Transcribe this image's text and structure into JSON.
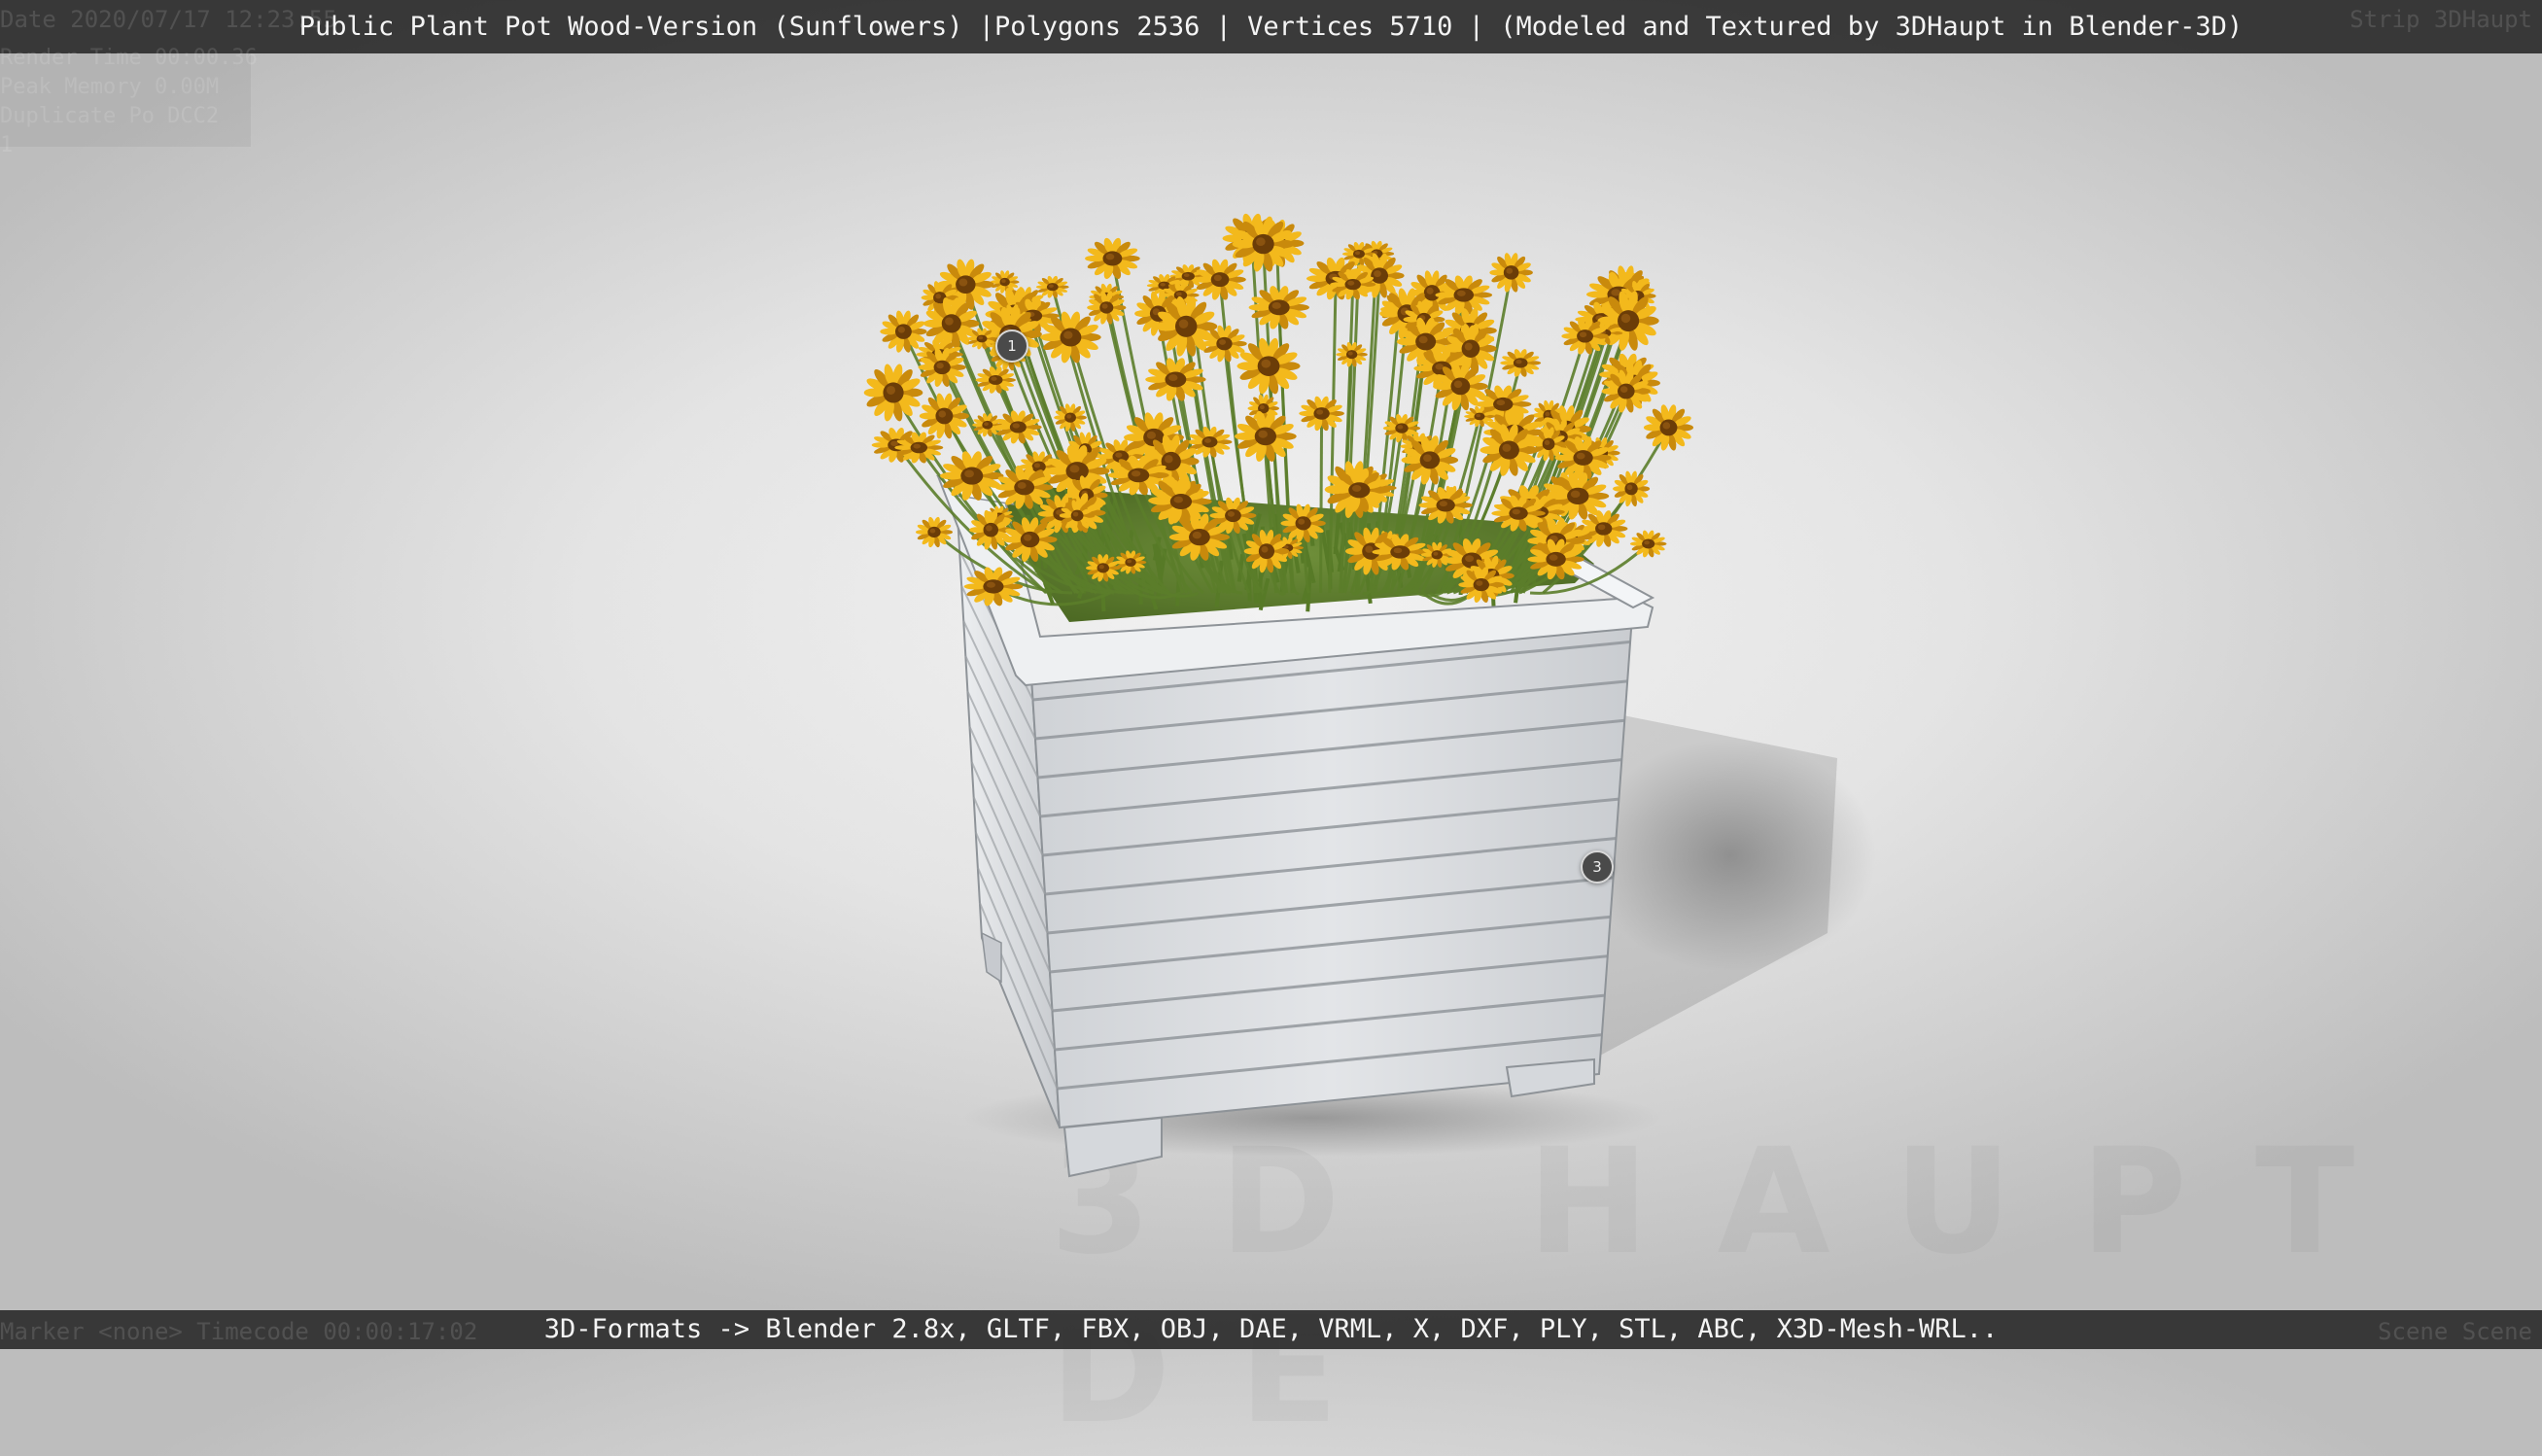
{
  "header": {
    "title": "Public Plant Pot Wood-Version (Sunflowers) |Polygons 2536 | Vertices 5710 | (Modeled and Textured by 3DHaupt in Blender-3D)",
    "overlay_left": "Date 2020/07/17 12:23:55",
    "overlay_right": "Strip 3DHaupt"
  },
  "info_panel": {
    "line1": "Render Time 00:00.36",
    "line2": "Peak Memory 0.00M",
    "line3": "Duplicate Po DCC2",
    "line4": "1"
  },
  "footer": {
    "formats": "3D-Formats -> Blender 2.8x, GLTF, FBX, OBJ, DAE, VRML, X, DXF, PLY, STL, ABC, X3D-Mesh-WRL..",
    "overlay_left": "Marker <none>   Timecode 00:00:17:02",
    "overlay_right": "Scene Scene"
  },
  "viewport": {
    "hotspots": [
      {
        "label": "1"
      },
      {
        "label": "3"
      }
    ],
    "watermark": "3D HAUPT DE",
    "colors": {
      "petal": "#f3b91c",
      "petal_dark": "#c98a0c",
      "flower_center": "#6b3d08",
      "stem": "#5b7d2a",
      "wood": "#dfe1e4",
      "wood_line": "#8e9398"
    }
  }
}
